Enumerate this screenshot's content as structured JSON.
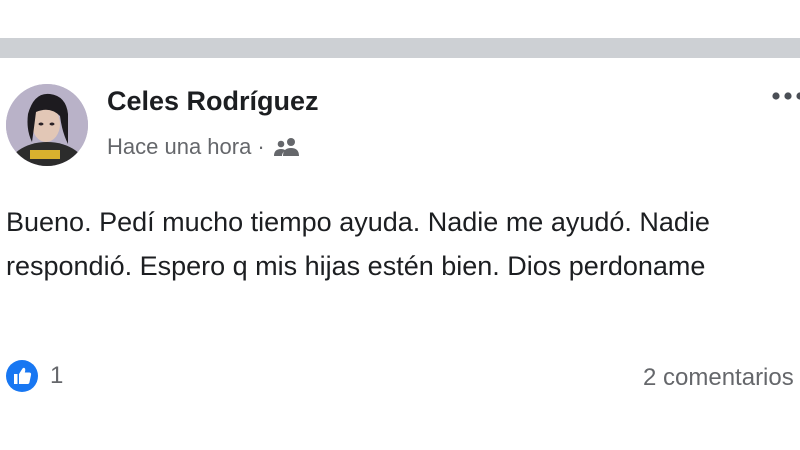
{
  "post": {
    "author": "Celes Rodríguez",
    "timestamp": "Hace una hora",
    "separator_dot": "·",
    "audience_icon": "friends-icon",
    "more_icon": "more-options-icon",
    "text": "Bueno. Pedí mucho tiempo ayuda. Nadie me ayudó. Nadie respondió. Espero q mis hijas estén bien. Dios perdoname",
    "reactions": {
      "like_icon": "like-icon",
      "count": "1"
    },
    "comments_label": "2 comentarios"
  },
  "colors": {
    "separator": "#cdd0d4",
    "text_primary": "#1c1e21",
    "text_secondary": "#65676b",
    "like_blue": "#1877f2"
  }
}
